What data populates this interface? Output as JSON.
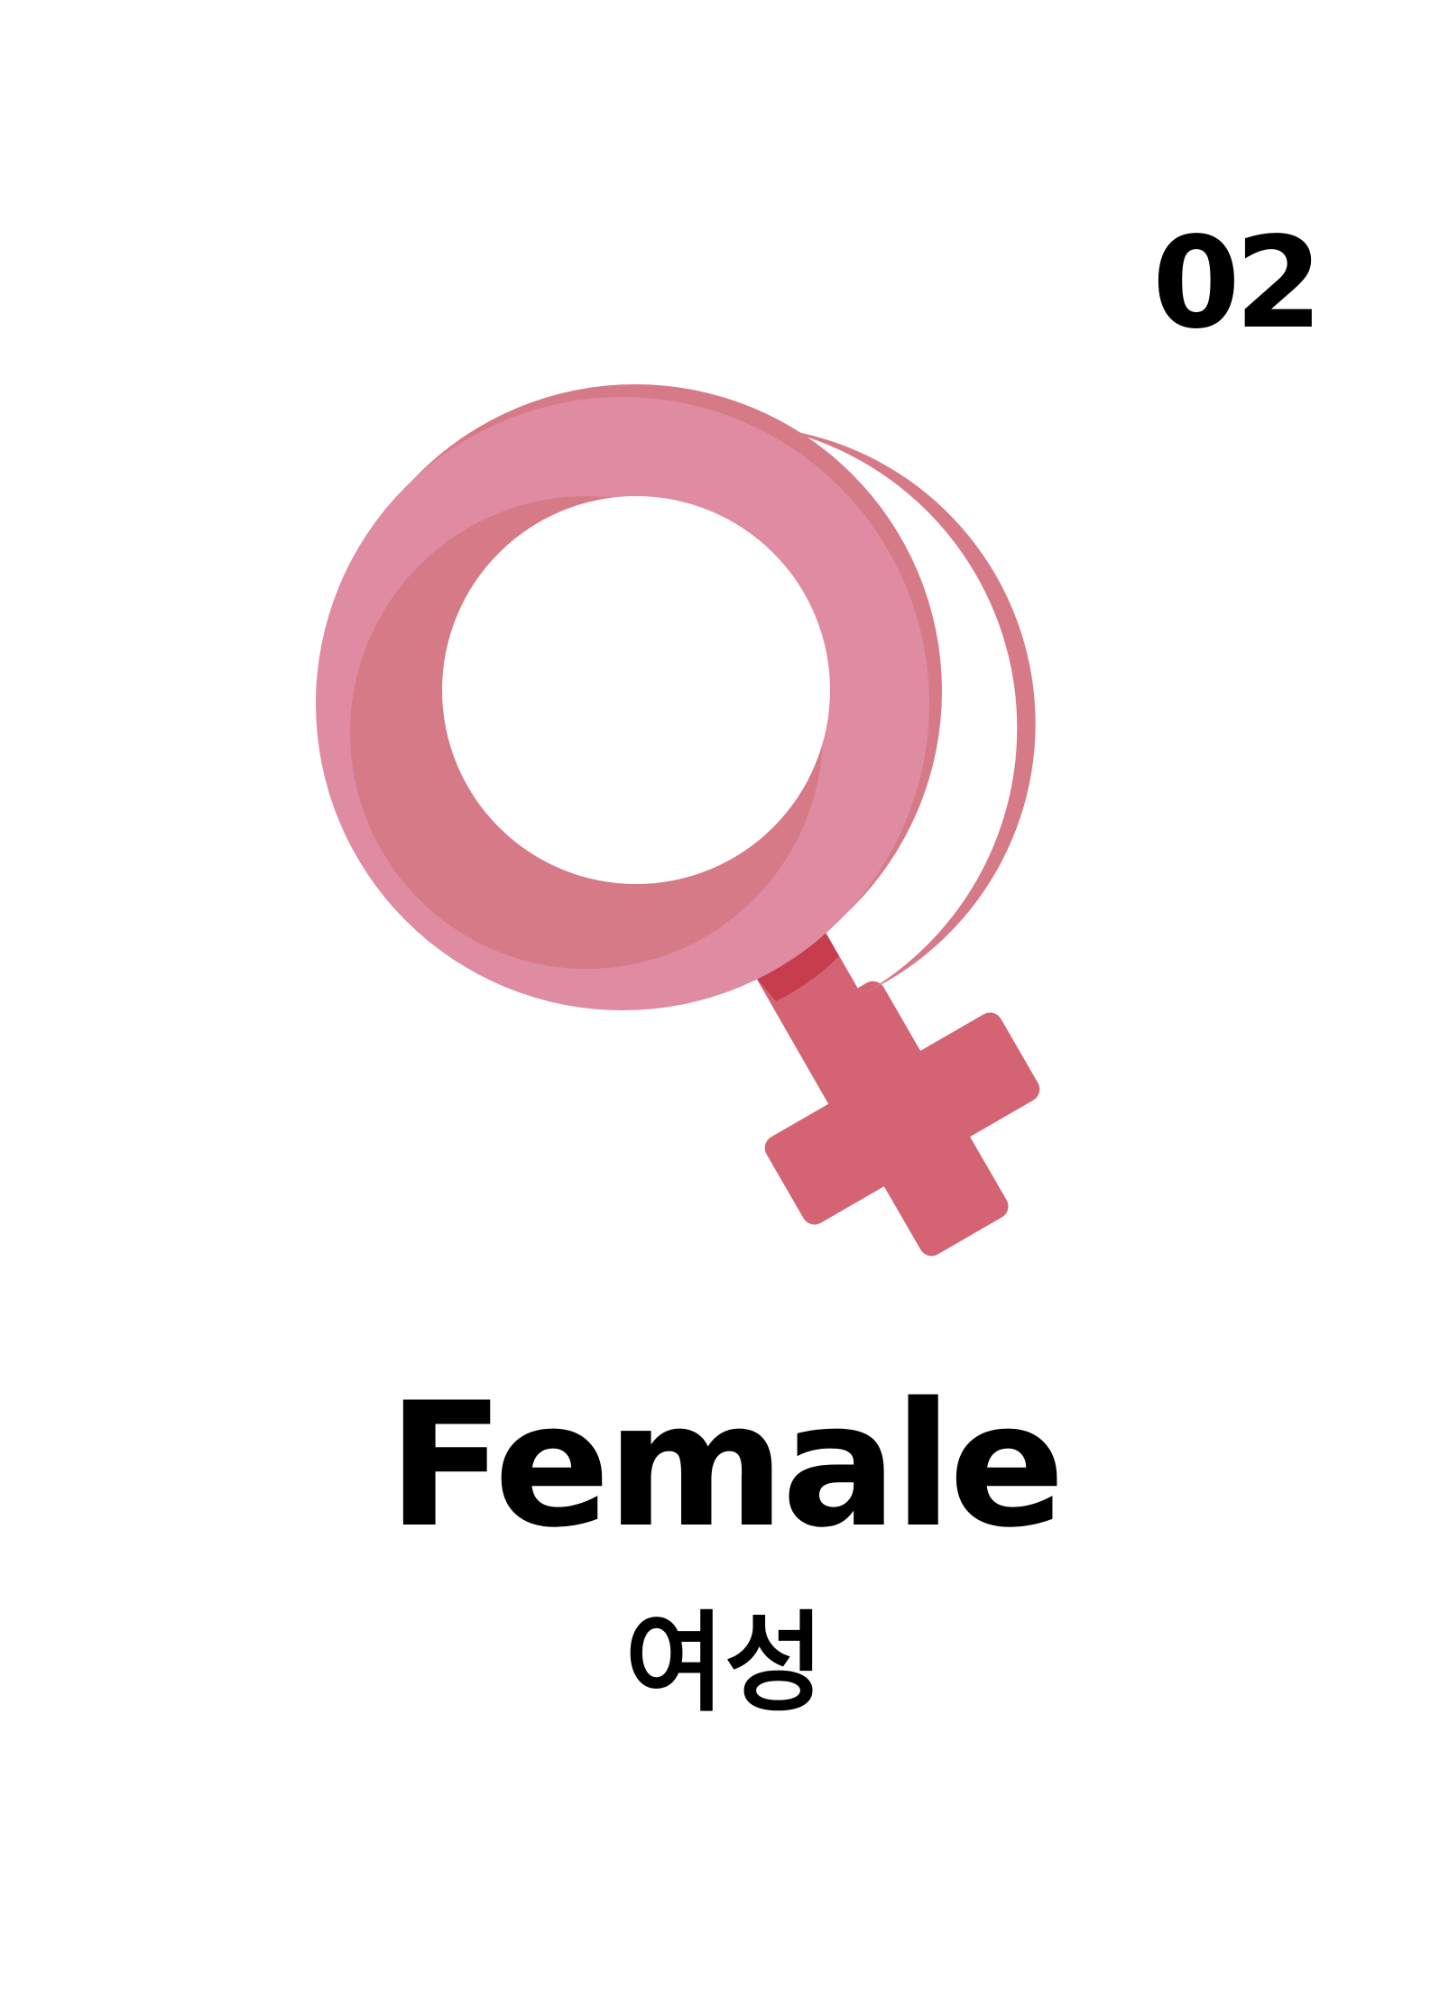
{
  "card": {
    "number": "02",
    "title_en": "Female",
    "title_ko": "여성",
    "icon": "female-symbol-icon"
  },
  "colors": {
    "ring_main": "#DF8BA1",
    "ring_shadow": "#D77A87",
    "stem": "#D46373",
    "stem_dark": "#C73D4E",
    "text": "#000000",
    "background": "#FFFFFF"
  }
}
